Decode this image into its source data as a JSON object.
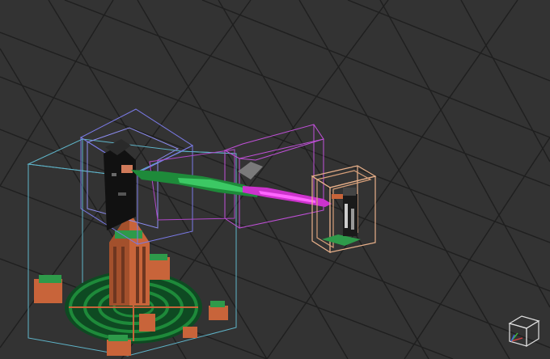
{
  "viewport": {
    "background": "#333333",
    "grid_color": "#1f1f1f"
  },
  "colors": {
    "box_cyan": "#5fb4c9",
    "box_blue": "#7a7ae6",
    "box_magenta": "#c050d8",
    "box_orange": "#e8b08a",
    "voxel_green": "#1e8a3a",
    "voxel_magenta": "#cc33cc",
    "voxel_orange": "#c8643a",
    "voxel_dark": "#111111"
  },
  "icons": {
    "view_cube": "view-cube-icon"
  }
}
